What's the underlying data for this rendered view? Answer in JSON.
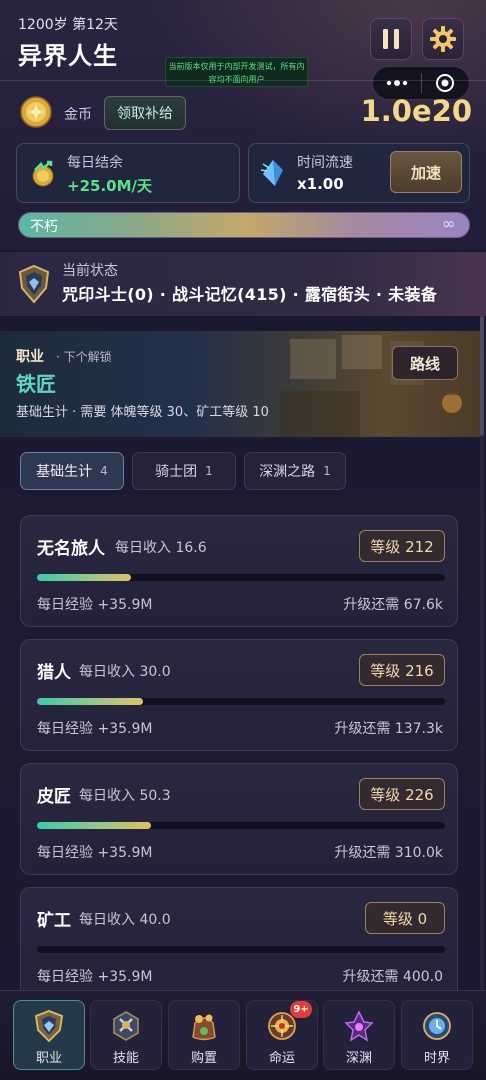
{
  "header": {
    "age_line": "1200岁 第12天",
    "title": "异界人生",
    "notice": "当前版本仅用于内部开发测试，所有内容均不面向用户"
  },
  "resources": {
    "coin_label": "金币",
    "claim_button": "领取补给",
    "gold_value": "1.0e20",
    "daily_title": "每日结余",
    "daily_value": "+25.0M/天",
    "time_title": "时间流速",
    "time_value": "x1.00",
    "speed_button": "加速",
    "life_label": "不朽",
    "life_icon": "∞"
  },
  "status": {
    "label": "当前状态",
    "value": "咒印斗士(0) · 战斗记忆(415) · 露宿街头 · 未装备"
  },
  "profession": {
    "label": "职业",
    "next_unlock": "· 下个解锁",
    "name": "铁匠",
    "requirement": "基础生计 · 需要 体魄等级 30、矿工等级 10",
    "route_button": "路线"
  },
  "tabs": [
    {
      "label": "基础生计",
      "count": "4"
    },
    {
      "label": "骑士团",
      "count": "1"
    },
    {
      "label": "深渊之路",
      "count": "1"
    }
  ],
  "jobs": [
    {
      "name": "无名旅人",
      "income": "每日收入 16.6",
      "level": "等级 212",
      "progress": 0.23,
      "exp": "每日经验 +35.9M",
      "need": "升级还需 67.6k"
    },
    {
      "name": "猎人",
      "income": "每日收入 30.0",
      "level": "等级 216",
      "progress": 0.26,
      "exp": "每日经验 +35.9M",
      "need": "升级还需 137.3k"
    },
    {
      "name": "皮匠",
      "income": "每日收入 50.3",
      "level": "等级 226",
      "progress": 0.28,
      "exp": "每日经验 +35.9M",
      "need": "升级还需 310.0k"
    },
    {
      "name": "矿工",
      "income": "每日收入 40.0",
      "level": "等级 0",
      "progress": 0.0,
      "exp": "每日经验 +35.9M",
      "need": "升级还需 400.0"
    }
  ],
  "nav": [
    {
      "label": "职业",
      "icon": "profession-icon"
    },
    {
      "label": "技能",
      "icon": "skill-icon"
    },
    {
      "label": "购置",
      "icon": "purchase-icon"
    },
    {
      "label": "命运",
      "icon": "fate-icon",
      "badge": "9+"
    },
    {
      "label": "深渊",
      "icon": "abyss-icon"
    },
    {
      "label": "时界",
      "icon": "time-realm-icon"
    }
  ],
  "colors": {
    "accent_teal": "#5fd6c4",
    "gold": "#f3d78a",
    "income_green": "#5fe08b"
  }
}
